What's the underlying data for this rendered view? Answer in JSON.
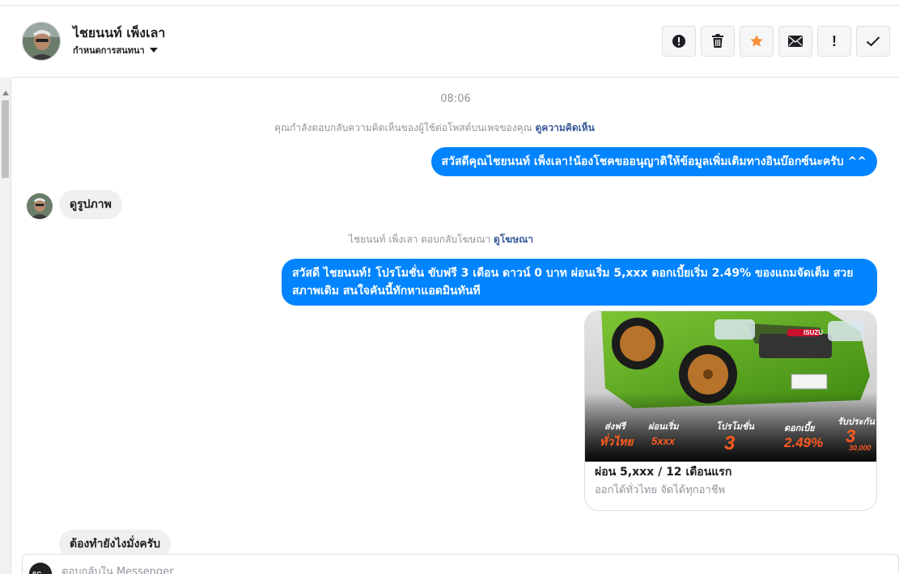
{
  "header": {
    "contact_name": "ไชยนนท์ เพ็งเลา",
    "assign_label": "กำหนดการสนทนา",
    "actions": [
      {
        "name": "mark-spam-button",
        "icon": "alert-circle-icon"
      },
      {
        "name": "delete-button",
        "icon": "trash-icon"
      },
      {
        "name": "star-button",
        "icon": "star-icon"
      },
      {
        "name": "mark-unread-button",
        "icon": "envelope-icon"
      },
      {
        "name": "follow-up-button",
        "icon": "exclamation-icon"
      },
      {
        "name": "mark-done-button",
        "icon": "check-icon"
      }
    ]
  },
  "conversation": {
    "timestamp": "08:06",
    "note1": {
      "text": "คุณกำลังตอบกลับความคิดเห็นของผู้ใช้ต่อโพสต์บนเพจของคุณ",
      "link": "ดูความคิดเห็น"
    },
    "msg_out_1": "สวัสดีคุณไชยนนท์ เพ็งเลา!น้องโชคขออนุญาติให้ข้อมูลเพิ่มเติมทางอินบ๊อกซ์นะครับ ^^",
    "msg_in_1": "ดูรูปภาพ",
    "note2": {
      "text": "ไชยนนท์ เพ็งเลา ตอบกลับโฆษณา",
      "link": "ดูโฆษณา"
    },
    "msg_out_2": "สวัสดี ไชยนนท์! โปรโมชั่น ขับฟรี 3 เดือน ดาวน์ 0 บาท ผ่อนเริ่ม 5,xxx  ดอกเบี้ยเริ่ม 2.49% ของแถมจัดเต็ม สวยสภาพเดิม สนใจคันนี้ทักหาแอดมินทันที",
    "ad_card": {
      "title": "ผ่อน 5,xxx / 12 เดือนแรก",
      "subtitle": "ออกได้ทั่วไทย จัดได้ทุกอาชีพ",
      "brand_badge": "ISUZU",
      "promos": [
        {
          "label": "ส่งฟรี",
          "value": "ทั่วไทย"
        },
        {
          "label": "ผ่อนเริ่ม",
          "value": "5xxx"
        },
        {
          "label": "โปรโมชั่น",
          "value": "3"
        },
        {
          "label": "ดอกเบี้ย",
          "value": "2.49%"
        },
        {
          "label": "รับประกัน",
          "value": "3",
          "extra": "30,000"
        }
      ]
    },
    "msg_in_2": "ต้องทำยังไงมั่งครับ"
  },
  "composer": {
    "placeholder": "ตอบกลับใน Messenger"
  },
  "colors": {
    "outgoing_bubble": "#0084ff",
    "incoming_bubble": "#f1f0f0",
    "star": "#f7923b",
    "link": "#385898",
    "muted": "#90949c"
  }
}
